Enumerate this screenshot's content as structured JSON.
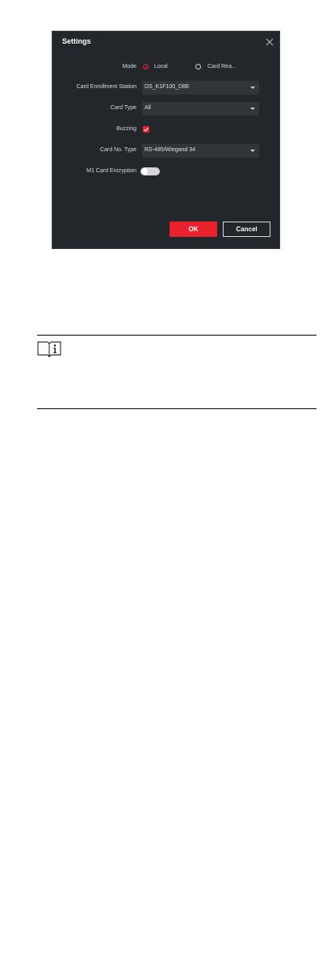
{
  "dialog": {
    "title": "Settings",
    "mode": {
      "label": "Mode",
      "options": [
        {
          "label": "Local",
          "selected": true
        },
        {
          "label": "Card Rea...",
          "selected": false
        }
      ]
    },
    "card_enrollment_station": {
      "label": "Card Enrollment Station",
      "value": "DS_K1F100_D8E"
    },
    "card_type": {
      "label": "Card Type",
      "value": "All"
    },
    "buzzing": {
      "label": "Buzzing",
      "checked": true
    },
    "card_no_type": {
      "label": "Card No. Type",
      "value": "RS-485/Wiegand 34"
    },
    "m1_card_encryption": {
      "label": "M1 Card Encryption",
      "enabled": false
    },
    "ok_label": "OK",
    "cancel_label": "Cancel"
  },
  "note": {
    "icon": "info-book-icon"
  },
  "colors": {
    "dialog_bg": "#23272b",
    "field_bg": "#30353a",
    "accent": "#e8212d"
  }
}
